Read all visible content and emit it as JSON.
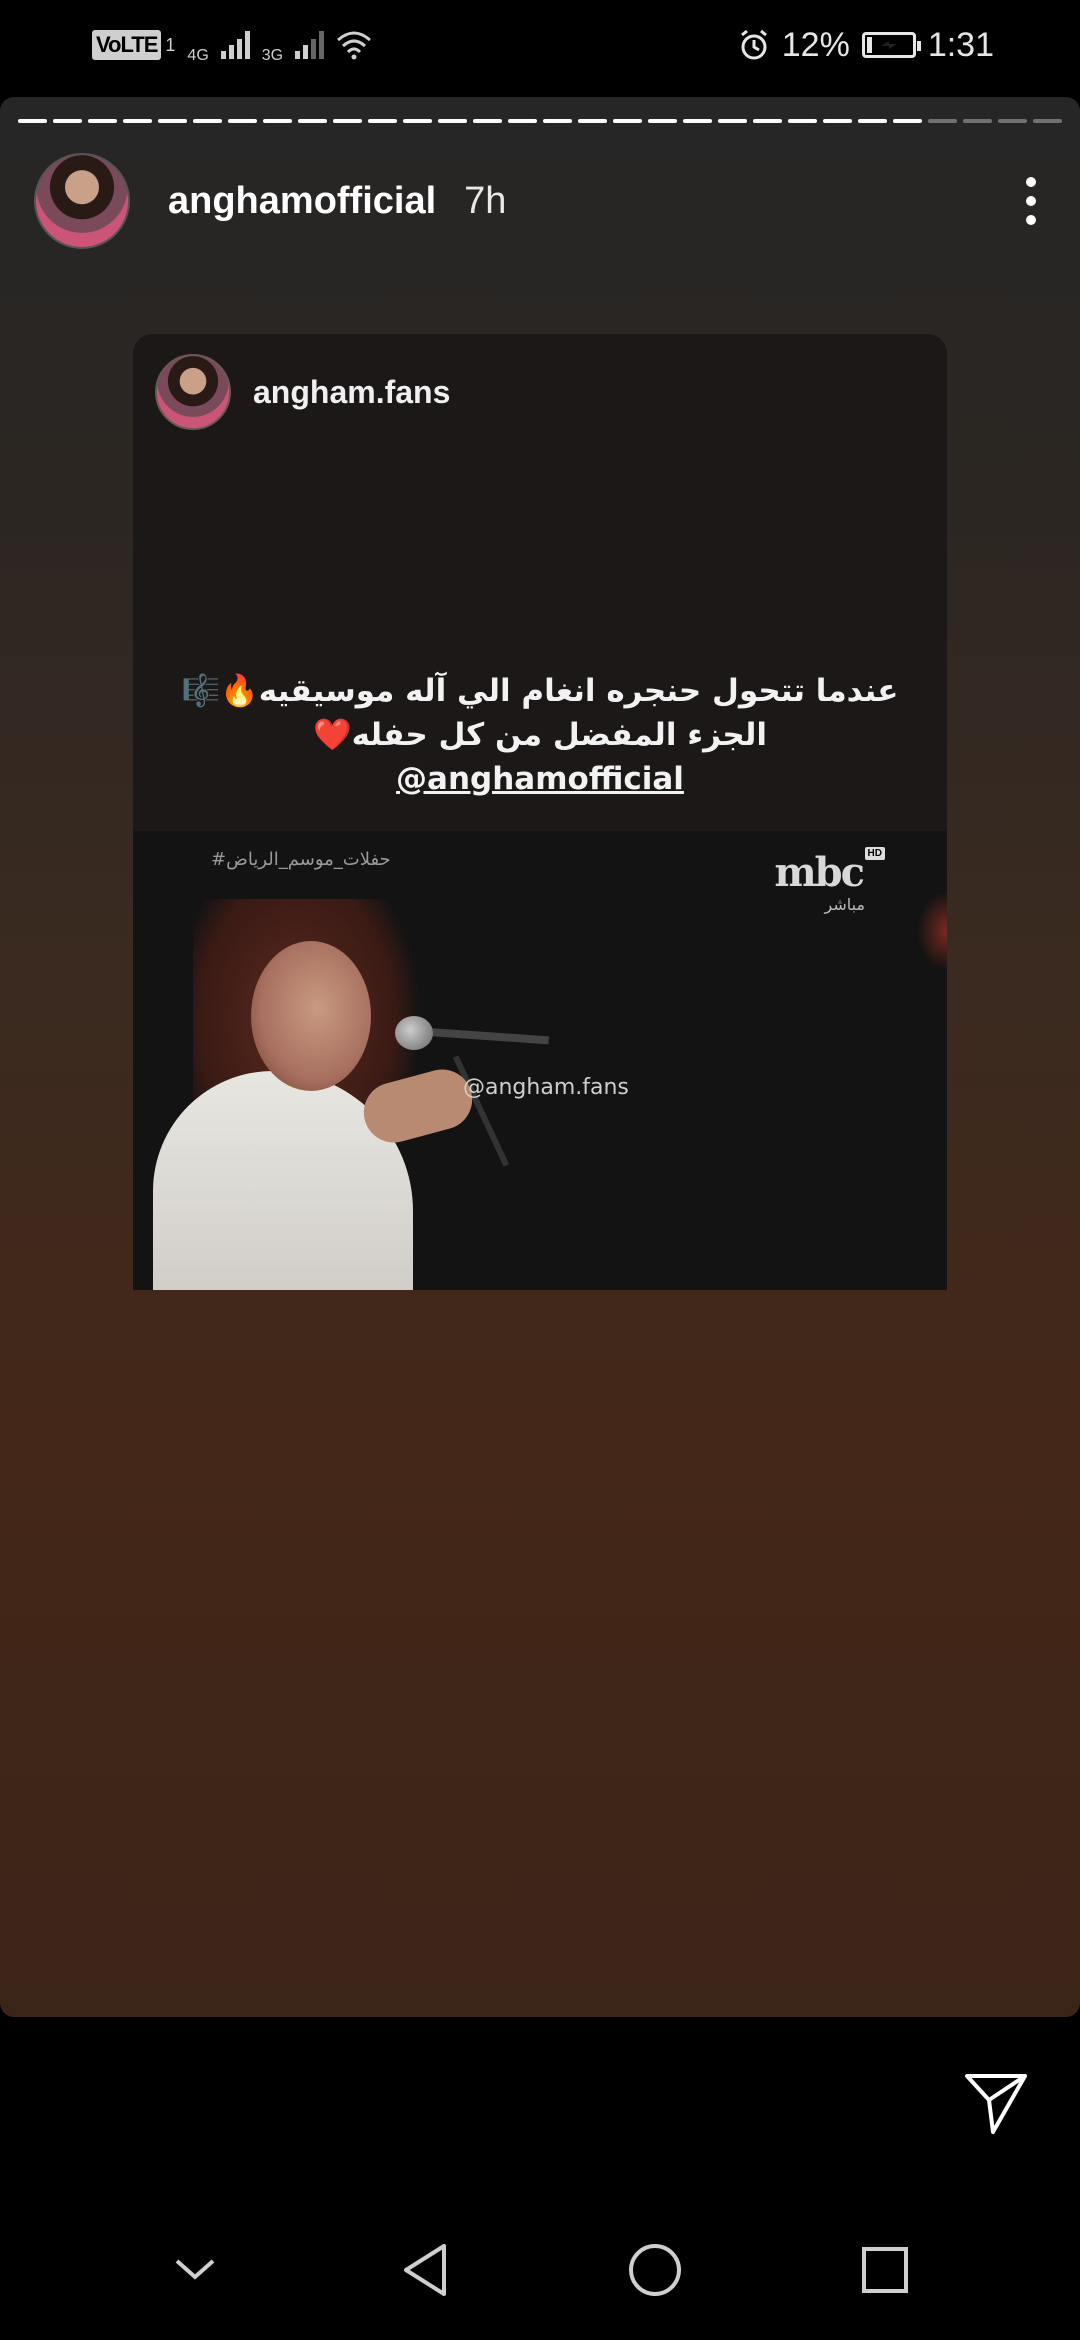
{
  "status_bar": {
    "volte": "VoLTE",
    "sim": "1",
    "net1": "4G",
    "net2": "3G",
    "battery_percent": "12%",
    "battery_level": 0.12,
    "time": "1:31"
  },
  "story": {
    "segments_total": 30,
    "segments_seen": 26,
    "username": "anghamofficial",
    "timestamp": "7h",
    "post": {
      "username": "angham.fans",
      "caption_line1": "عندما تتحول حنجره انغام الي آله موسيقيه🔥🎼",
      "caption_line2": "الجزء المفضل من كل حفله❤️",
      "caption_mention": "@anghamofficial",
      "video": {
        "hashtag": "#حفلات_موسم_الرياض",
        "channel": "mbc",
        "channel_sub": "مباشر",
        "hd": "HD",
        "watermark": "@angham.fans"
      }
    }
  },
  "icons": {
    "more": "more-vertical-icon",
    "send": "send-icon",
    "nav_collapse": "chevron-down-icon",
    "nav_back": "back-triangle-icon",
    "nav_home": "home-circle-icon",
    "nav_recents": "recents-square-icon"
  }
}
